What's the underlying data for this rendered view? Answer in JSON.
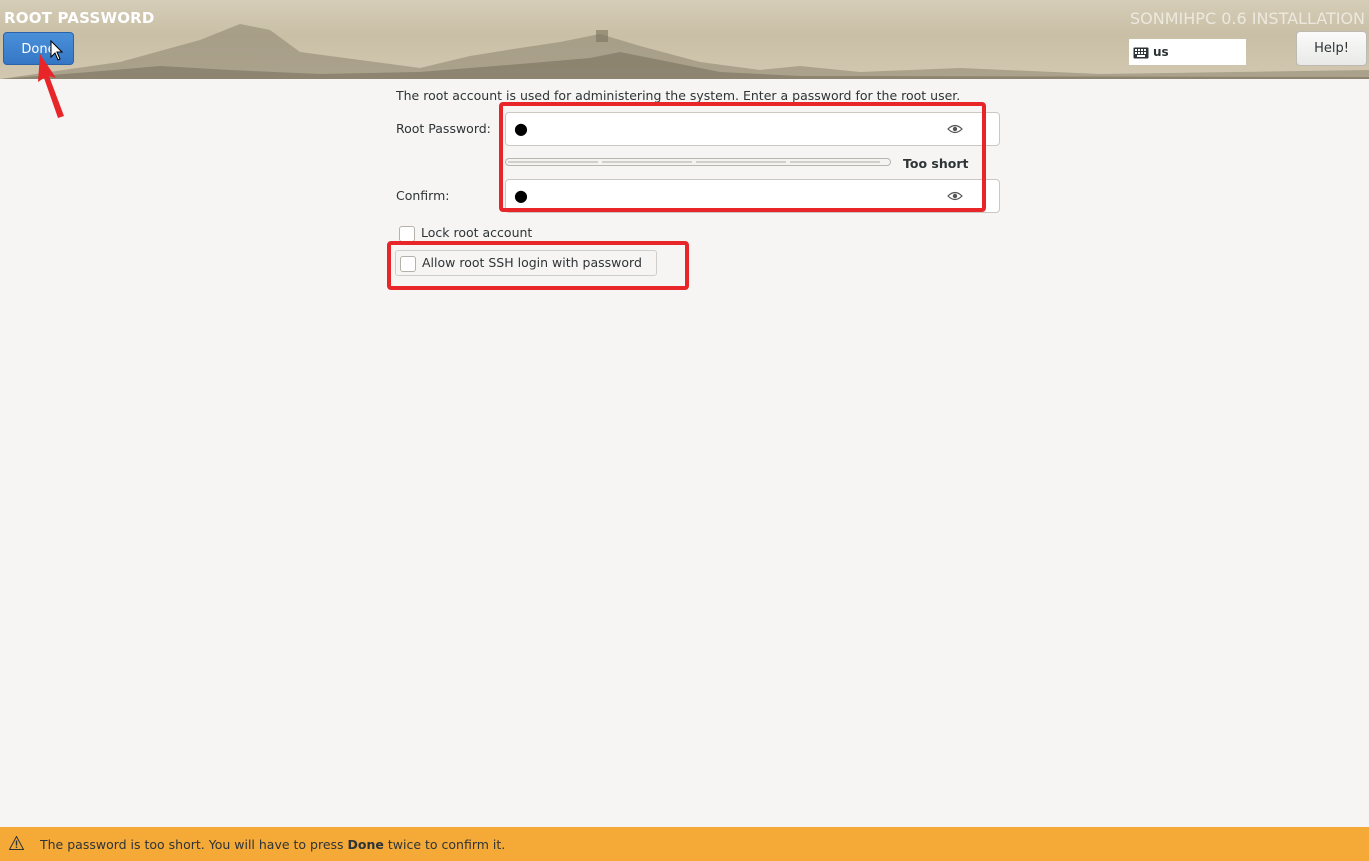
{
  "header": {
    "page_title": "ROOT PASSWORD",
    "done_label": "Done",
    "product_title": "SONMIHPC 0.6 INSTALLATION",
    "keyboard_layout": "us",
    "help_label": "Help!"
  },
  "form": {
    "intro": "The root account is used for administering the system.  Enter a password for the root user.",
    "root_password_label": "Root Password:",
    "root_password_value": "●",
    "strength_label": "Too short",
    "strength_level": 0,
    "confirm_label": "Confirm:",
    "confirm_value": "●",
    "lock_root_label": "Lock root account",
    "lock_root_checked": false,
    "ssh_label": "Allow root SSH login with password",
    "ssh_checked": false
  },
  "status_bar": {
    "message_prefix": "The password is too short. You will have to press ",
    "message_bold": "Done",
    "message_suffix": " twice to confirm it."
  },
  "colors": {
    "accent": "#3577c5",
    "warning_bar": "#f5a937",
    "annotation": "#e8262a"
  },
  "icons": {
    "keyboard": "keyboard-icon",
    "eye": "eye-icon",
    "warning": "warning-icon"
  }
}
